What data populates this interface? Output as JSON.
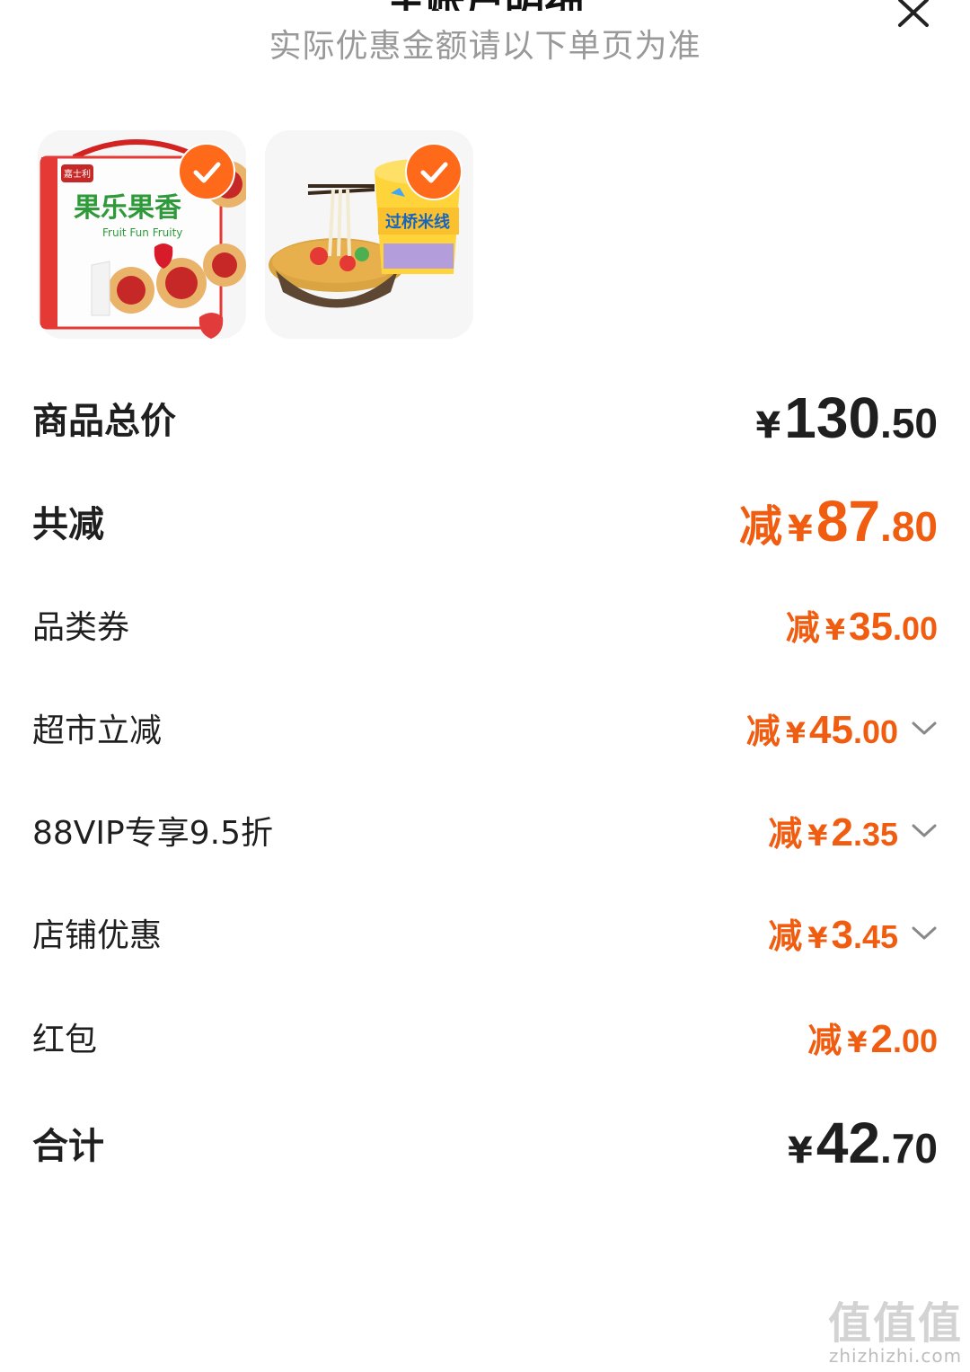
{
  "header": {
    "title": "主账户明细",
    "subtitle": "实际优惠金额请以下单页为准"
  },
  "products": [
    {
      "name": "果乐果香",
      "subtitle": "Fruit Fun Fruity",
      "brand": "嘉士利",
      "selected": true
    },
    {
      "name": "过桥米线",
      "selected": true
    }
  ],
  "summary": {
    "goods_total": {
      "label": "商品总价",
      "currency": "¥",
      "int": "130",
      "dec": ".50"
    },
    "total_discount": {
      "label": "共减",
      "prefix": "减",
      "currency": "¥",
      "int": "87",
      "dec": ".80"
    },
    "items": [
      {
        "label": "品类券",
        "prefix": "减",
        "currency": "¥",
        "int": "35",
        "dec": ".00",
        "expandable": false
      },
      {
        "label": "超市立减",
        "prefix": "减",
        "currency": "¥",
        "int": "45",
        "dec": ".00",
        "expandable": true
      },
      {
        "label": "88VIP专享9.5折",
        "prefix": "减",
        "currency": "¥",
        "int": "2",
        "dec": ".35",
        "expandable": true
      },
      {
        "label": "店铺优惠",
        "prefix": "减",
        "currency": "¥",
        "int": "3",
        "dec": ".45",
        "expandable": true
      },
      {
        "label": "红包",
        "prefix": "减",
        "currency": "¥",
        "int": "2",
        "dec": ".00",
        "expandable": false
      }
    ],
    "grand_total": {
      "label": "合计",
      "currency": "¥",
      "int": "42",
      "dec": ".70"
    }
  },
  "watermark": {
    "logo": "值值值",
    "url": "zhizhizhi.com"
  },
  "colors": {
    "accent": "#f15d10",
    "check": "#ff6a1a",
    "text": "#1f1f1f",
    "subtle": "#999999"
  }
}
